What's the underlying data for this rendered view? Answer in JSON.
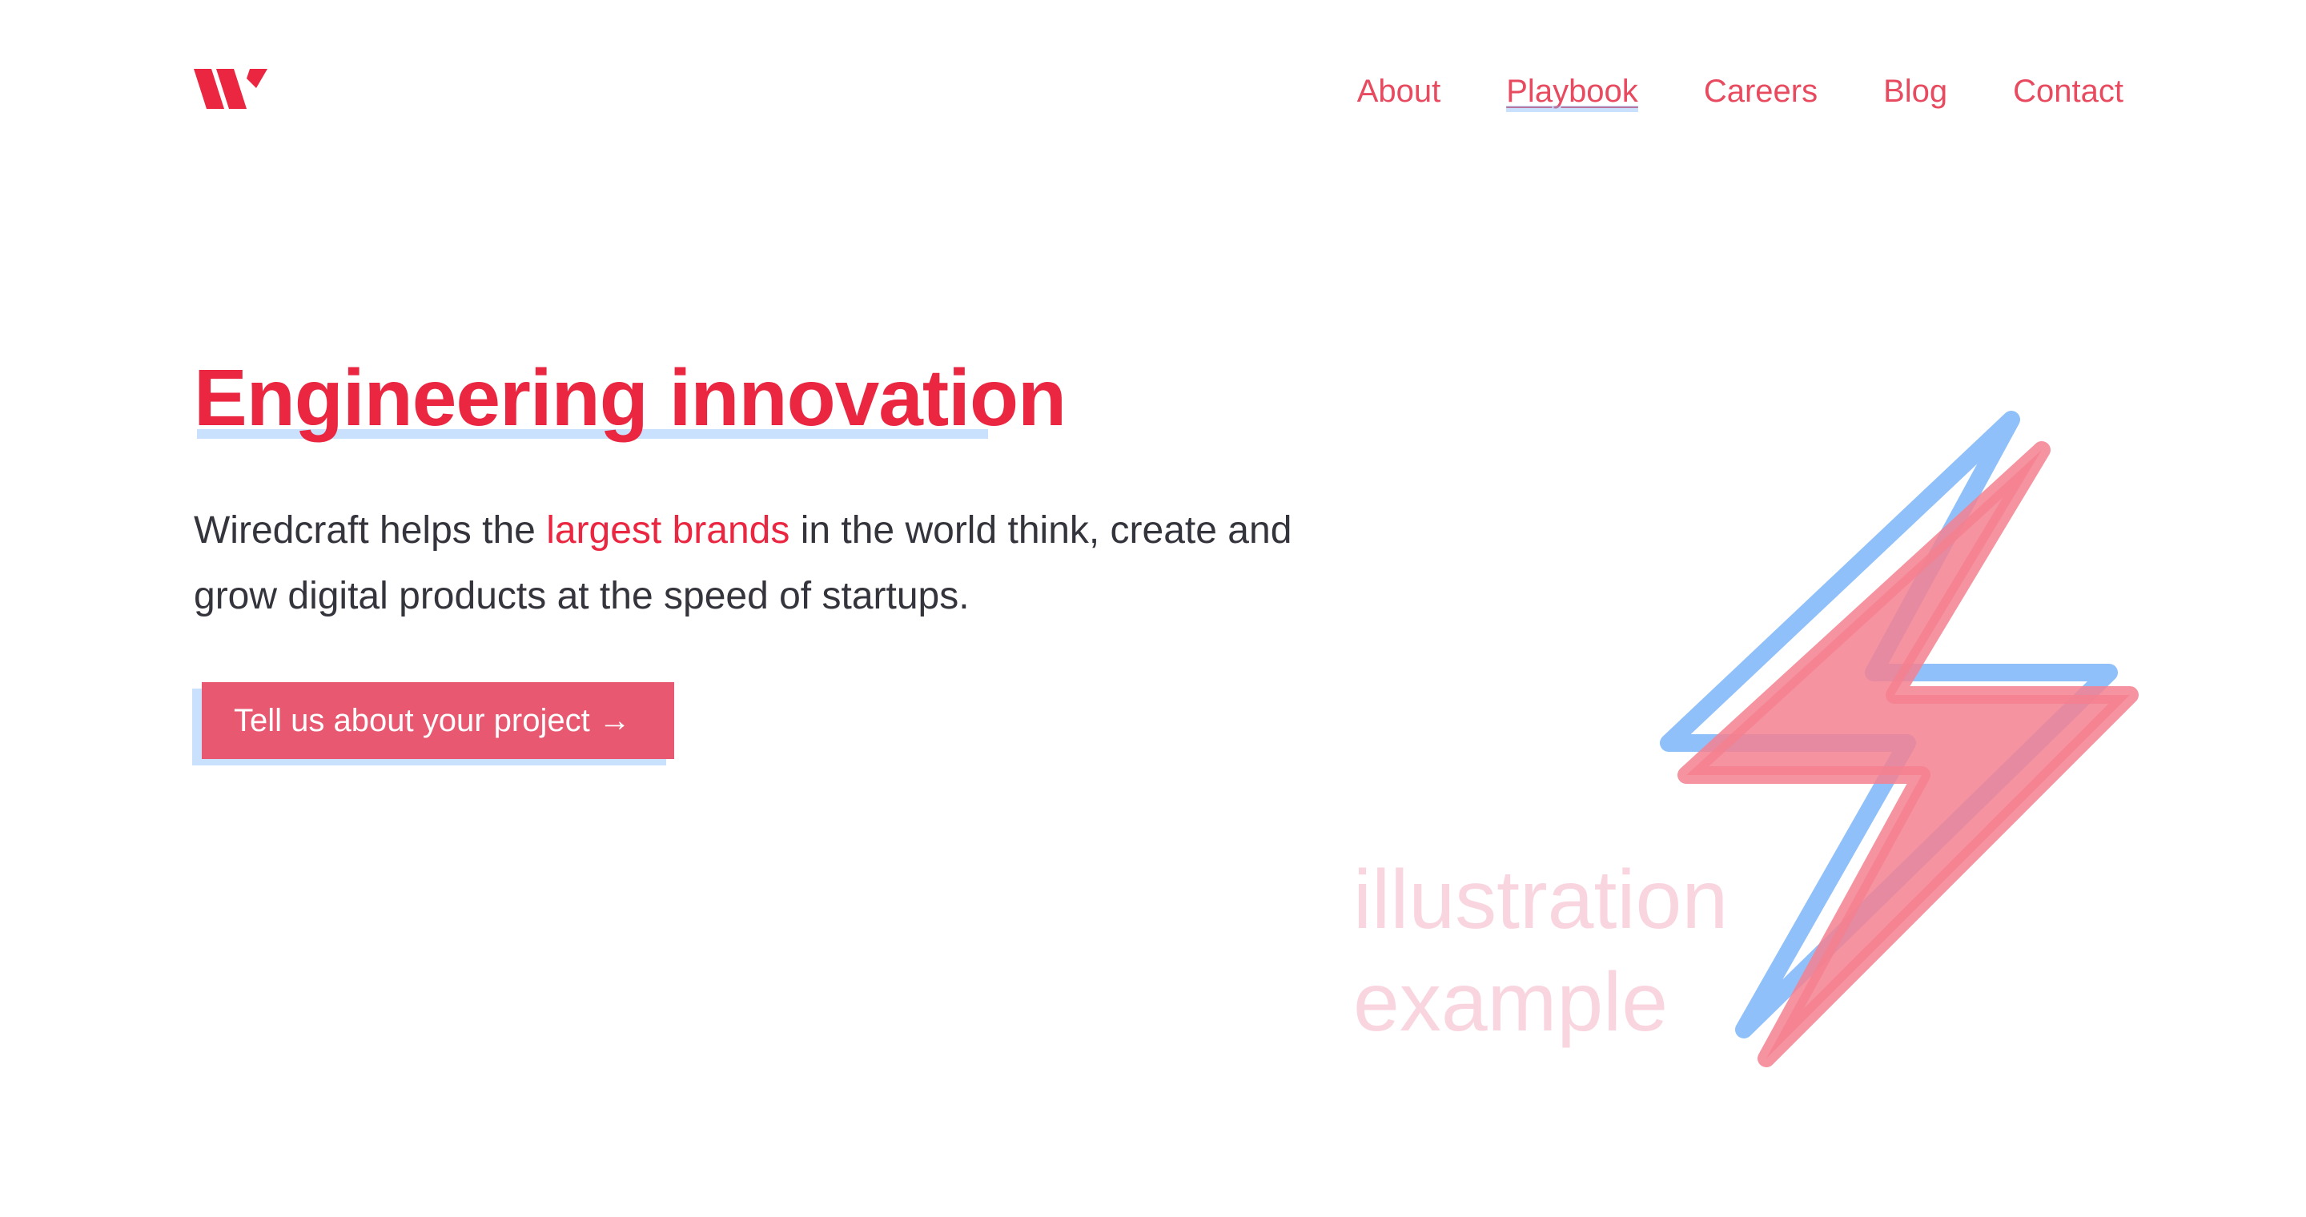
{
  "brand": {
    "logo_icon": "wiredcraft-w-logo-icon",
    "accent_color": "#ea2641",
    "nav_color": "#e84a5f",
    "highlight_color": "#78b4fa"
  },
  "nav": {
    "items": [
      {
        "label": "About"
      },
      {
        "label": "Playbook"
      },
      {
        "label": "Careers"
      },
      {
        "label": "Blog"
      },
      {
        "label": "Contact"
      }
    ]
  },
  "hero": {
    "title": "Engineering innovation",
    "description": {
      "before": "Wiredcraft helps the ",
      "highlight": "largest brands",
      "after": " in the world think, create and grow digital products at the speed of startups."
    },
    "cta_label": "Tell us about your project →",
    "cta_color": "#e85870"
  },
  "illustration": {
    "caption_line1": "illustration",
    "caption_line2": "example",
    "icon": "lightning-bolt-icon",
    "outline_color": "#8fc0fa",
    "fill_color": "#f5808f"
  }
}
